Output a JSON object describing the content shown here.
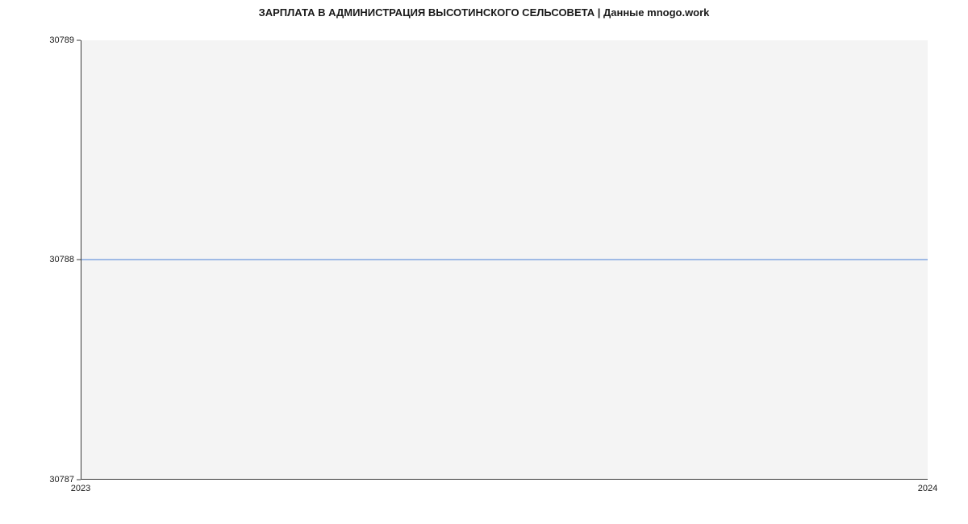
{
  "chart_data": {
    "type": "line",
    "title": "ЗАРПЛАТА В АДМИНИСТРАЦИЯ ВЫСОТИНСКОГО СЕЛЬСОВЕТА | Данные mnogo.work",
    "x": [
      2023,
      2024
    ],
    "y": [
      30788,
      30788
    ],
    "xlabel": "",
    "ylabel": "",
    "xlim": [
      2023,
      2024
    ],
    "ylim": [
      30787,
      30789
    ],
    "x_ticks": [
      "2023",
      "2024"
    ],
    "y_ticks": [
      "30787",
      "30788",
      "30789"
    ],
    "line_color": "#4a7fd6",
    "plot_bg": "#f4f4f4"
  }
}
